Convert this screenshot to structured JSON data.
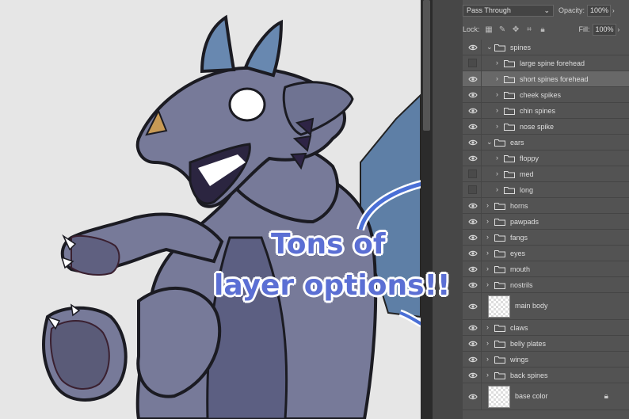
{
  "blend": {
    "mode": "Pass Through",
    "opacity_label": "Opacity:",
    "opacity_value": "100%"
  },
  "lock": {
    "label": "Lock:",
    "fill_label": "Fill:",
    "fill_value": "100%"
  },
  "layers": [
    {
      "name": "spines",
      "type": "group",
      "open": true,
      "indent": 0,
      "visible": true
    },
    {
      "name": "large spine forehead",
      "type": "group",
      "open": false,
      "indent": 1,
      "visible": false
    },
    {
      "name": "short spines forehead",
      "type": "group",
      "open": false,
      "indent": 1,
      "visible": true,
      "selected": true
    },
    {
      "name": "cheek spikes",
      "type": "group",
      "open": false,
      "indent": 1,
      "visible": true
    },
    {
      "name": "chin spines",
      "type": "group",
      "open": false,
      "indent": 1,
      "visible": true
    },
    {
      "name": "nose spike",
      "type": "group",
      "open": false,
      "indent": 1,
      "visible": true
    },
    {
      "name": "ears",
      "type": "group",
      "open": true,
      "indent": 0,
      "visible": true
    },
    {
      "name": "floppy",
      "type": "group",
      "open": false,
      "indent": 1,
      "visible": true
    },
    {
      "name": "med",
      "type": "group",
      "open": false,
      "indent": 1,
      "visible": false
    },
    {
      "name": "long",
      "type": "group",
      "open": false,
      "indent": 1,
      "visible": false
    },
    {
      "name": "horns",
      "type": "group",
      "open": false,
      "indent": 0,
      "visible": true
    },
    {
      "name": "pawpads",
      "type": "group",
      "open": false,
      "indent": 0,
      "visible": true
    },
    {
      "name": "fangs",
      "type": "group",
      "open": false,
      "indent": 0,
      "visible": true
    },
    {
      "name": "eyes",
      "type": "group",
      "open": false,
      "indent": 0,
      "visible": true
    },
    {
      "name": "mouth",
      "type": "group",
      "open": false,
      "indent": 0,
      "visible": true
    },
    {
      "name": "nostrils",
      "type": "group",
      "open": false,
      "indent": 0,
      "visible": true
    },
    {
      "name": "main body",
      "type": "pixel",
      "indent": 0,
      "visible": true
    },
    {
      "name": "claws",
      "type": "group",
      "open": false,
      "indent": 0,
      "visible": true
    },
    {
      "name": "belly plates",
      "type": "group",
      "open": false,
      "indent": 0,
      "visible": true
    },
    {
      "name": "wings",
      "type": "group",
      "open": false,
      "indent": 0,
      "visible": true
    },
    {
      "name": "back spines",
      "type": "group",
      "open": false,
      "indent": 0,
      "visible": true
    },
    {
      "name": "base color",
      "type": "pixel",
      "indent": 0,
      "visible": true,
      "locked": true
    }
  ],
  "overlay": {
    "line1": "Tons of",
    "line2": "layer options!!",
    "color": "#5b6fd4"
  },
  "colors": {
    "panel": "#535353",
    "selected_row": "#686868",
    "dragon_body": "#7a7d9c",
    "dragon_horn": "#6a88b0",
    "arrow": "#4a6fd6"
  }
}
